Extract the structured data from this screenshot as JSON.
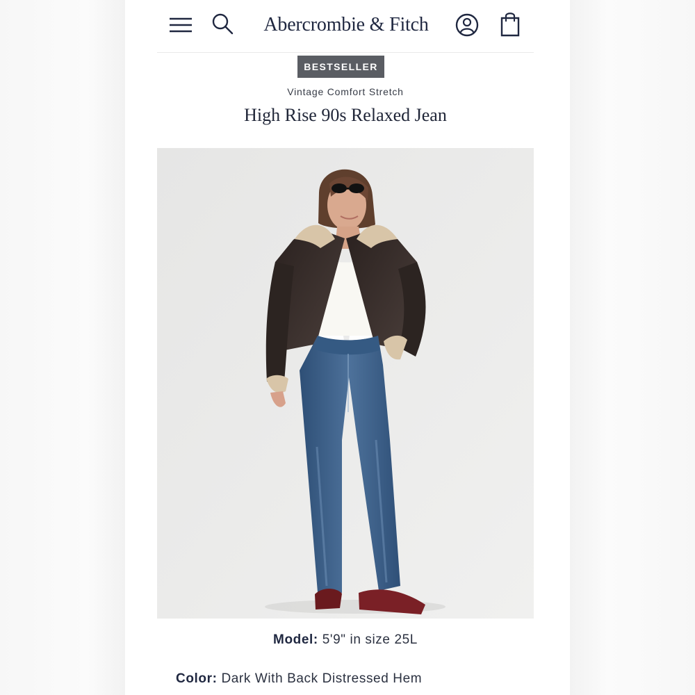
{
  "brand": {
    "logo_text": "Abercrombie & Fitch"
  },
  "header": {
    "icons": {
      "menu": "menu-icon",
      "search": "search-icon",
      "account": "account-icon",
      "bag": "shopping-bag-icon"
    }
  },
  "product": {
    "badge": "BESTSELLER",
    "collection": "Vintage Comfort Stretch",
    "title": "High Rise 90s Relaxed Jean",
    "model_label": "Model:",
    "model_value": "5'9\" in size 25L",
    "color_label": "Color:",
    "color_value": "Dark With Back Distressed Hem"
  },
  "colors": {
    "badge_background": "#5a5d63",
    "text_primary": "#1f2740",
    "photo_background": "#e8e8e8"
  }
}
